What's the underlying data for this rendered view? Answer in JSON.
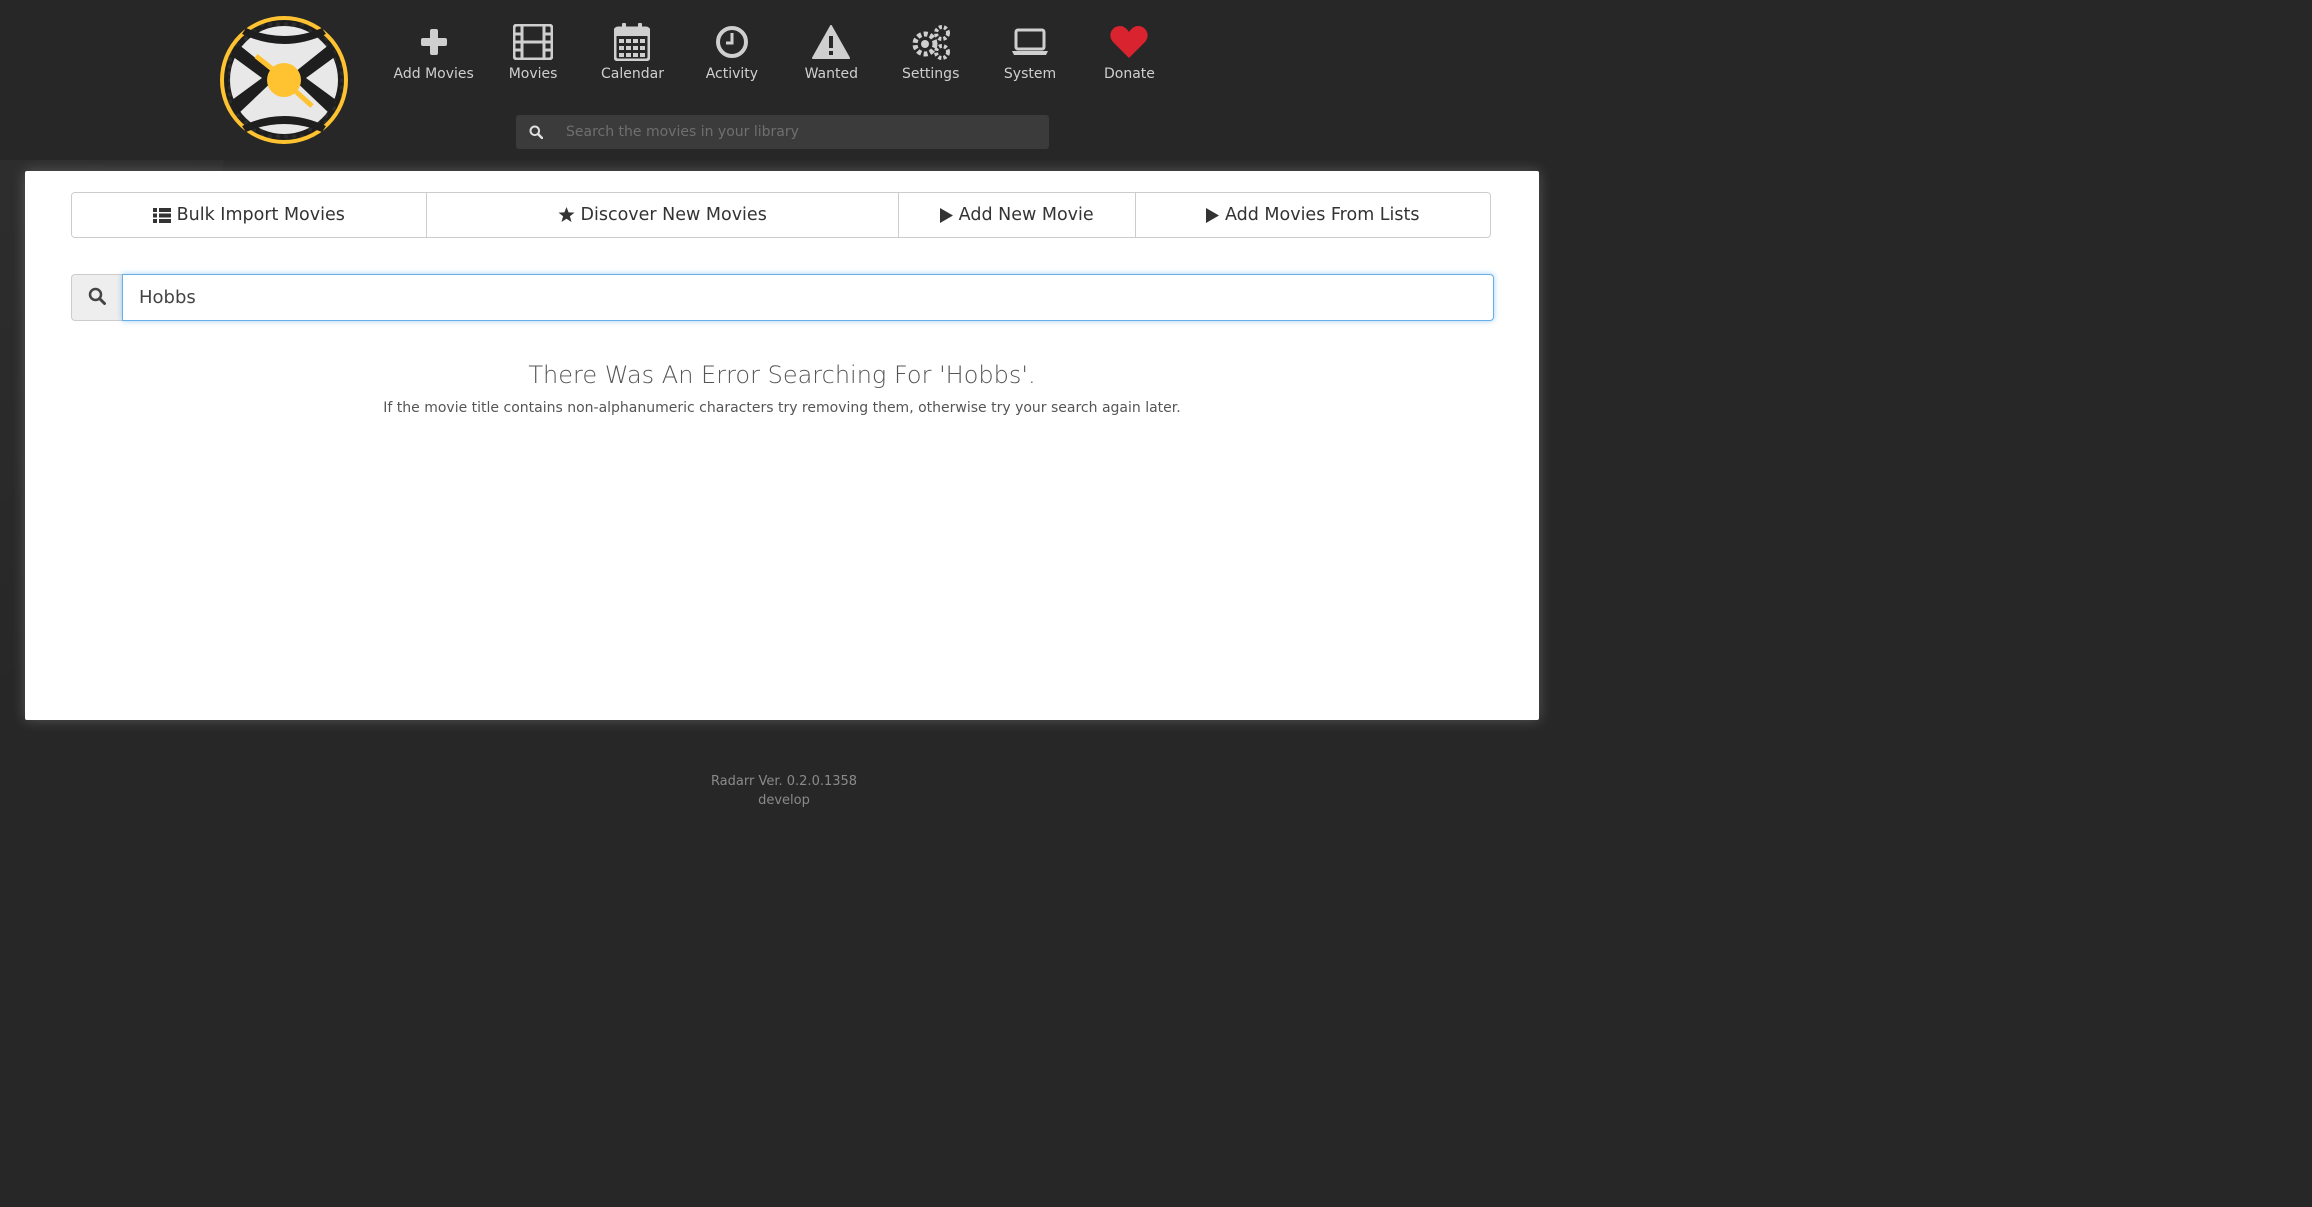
{
  "nav": {
    "items": [
      {
        "label": "Add Movies",
        "icon": "plus-icon"
      },
      {
        "label": "Movies",
        "icon": "film-icon"
      },
      {
        "label": "Calendar",
        "icon": "calendar-icon"
      },
      {
        "label": "Activity",
        "icon": "clock-icon"
      },
      {
        "label": "Wanted",
        "icon": "warning-icon"
      },
      {
        "label": "Settings",
        "icon": "gears-icon"
      },
      {
        "label": "System",
        "icon": "laptop-icon"
      },
      {
        "label": "Donate",
        "icon": "heart-icon"
      }
    ],
    "search_placeholder": "Search the movies in your library"
  },
  "actions": {
    "bulk_import": "Bulk Import Movies",
    "discover": "Discover New Movies",
    "add_new": "Add New Movie",
    "add_from_lists": "Add Movies From Lists"
  },
  "search": {
    "value": "Hobbs"
  },
  "error": {
    "title": "There Was An Error Searching For 'Hobbs'.",
    "message": "If the movie title contains non-alphanumeric characters try removing them, otherwise try your search again later."
  },
  "footer": {
    "version": "Radarr Ver. 0.2.0.1358",
    "branch": "develop"
  },
  "colors": {
    "background": "#272727",
    "nav_text": "#cfcfcf",
    "donate_heart": "#d9232e",
    "logo_yellow": "#ffc230"
  }
}
